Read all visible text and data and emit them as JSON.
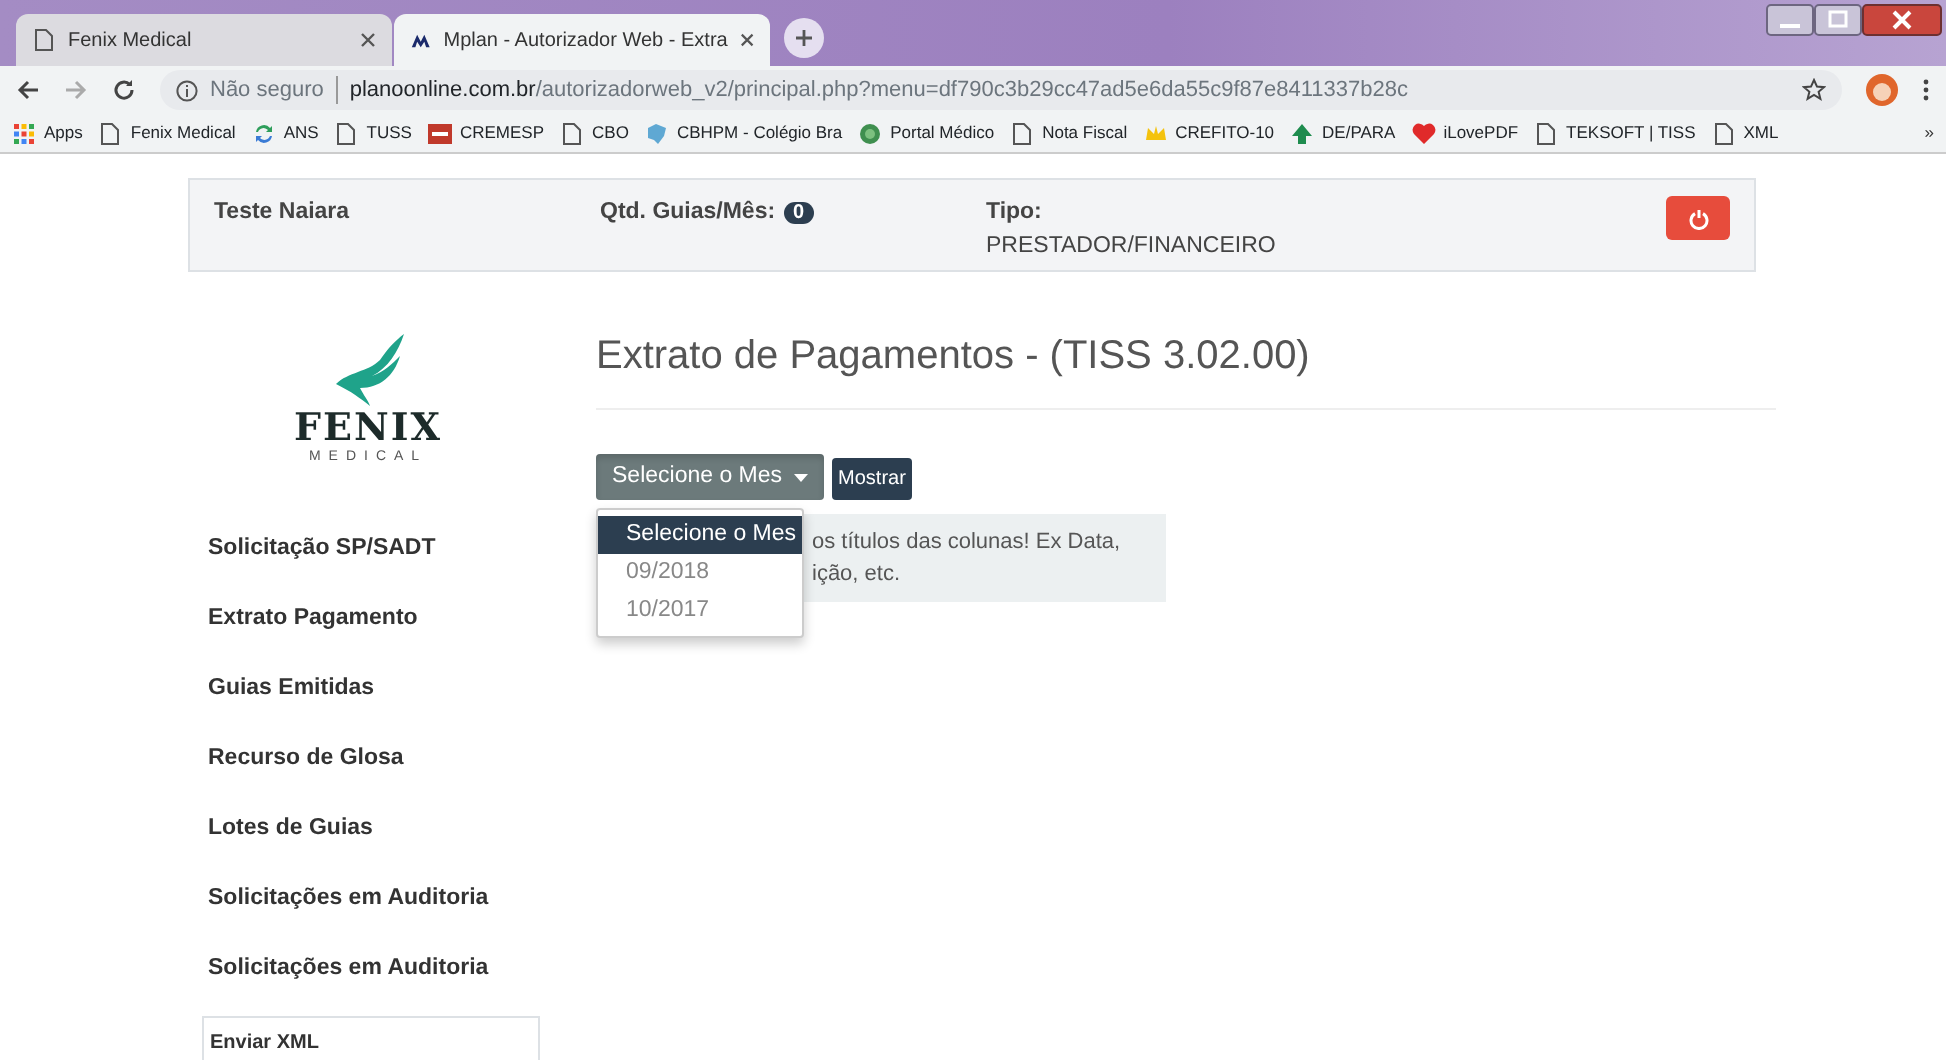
{
  "browser": {
    "tabs": [
      {
        "title": "Fenix Medical",
        "kind": "page",
        "selected": false
      },
      {
        "title": "Mplan - Autorizador Web - Extra",
        "kind": "mplan",
        "selected": true
      }
    ],
    "address": {
      "security": "Não seguro",
      "host": "planoonline.com.br",
      "path": "/autorizadorweb_v2/principal.php?menu=df790c3b29cc47ad5e6da55c9f87e8411337b28c"
    },
    "bookmarks": [
      {
        "label": "Apps",
        "kind": "apps"
      },
      {
        "label": "Fenix Medical",
        "kind": "page"
      },
      {
        "label": "ANS",
        "kind": "arrows"
      },
      {
        "label": "TUSS",
        "kind": "page"
      },
      {
        "label": "CREMESP",
        "kind": "badge"
      },
      {
        "label": "CBO",
        "kind": "page"
      },
      {
        "label": "CBHPM - Colégio Bra",
        "kind": "map"
      },
      {
        "label": "Portal Médico",
        "kind": "circle"
      },
      {
        "label": "Nota Fiscal",
        "kind": "page"
      },
      {
        "label": "CREFITO-10",
        "kind": "crown"
      },
      {
        "label": "DE/PARA",
        "kind": "tree"
      },
      {
        "label": "iLovePDF",
        "kind": "heart"
      },
      {
        "label": "TEKSOFT | TISS",
        "kind": "page"
      },
      {
        "label": "XML",
        "kind": "page"
      }
    ],
    "bookmarks_more": "»"
  },
  "header": {
    "user": "Teste Naiara",
    "qty_label": "Qtd. Guias/Mês:",
    "qty_count": "0",
    "tipo_label": "Tipo:",
    "tipo_value": "PRESTADOR/FINANCEIRO"
  },
  "sidebar": {
    "logo": {
      "name": "FENIX",
      "sub": "MEDICAL"
    },
    "items": [
      {
        "label": "Solicitação SP/SADT",
        "selected": false
      },
      {
        "label": "Extrato Pagamento",
        "selected": false
      },
      {
        "label": "Guias Emitidas",
        "selected": false
      },
      {
        "label": "Recurso de Glosa",
        "selected": false
      },
      {
        "label": "Lotes de Guias",
        "selected": false
      },
      {
        "label": "Solicitações em Auditoria",
        "selected": false
      },
      {
        "label": "Solicitações em Auditoria",
        "selected": false
      },
      {
        "label": "Enviar XML",
        "selected": true
      }
    ]
  },
  "main": {
    "title": "Extrato de Pagamentos - (TISS 3.02.00)",
    "month_select": {
      "label": "Selecione o Mes",
      "expanded": true
    },
    "show_button": "Mostrar",
    "month_options": [
      {
        "label": "Selecione o Mes",
        "selected": true
      },
      {
        "label": "09/2018",
        "selected": false
      },
      {
        "label": "10/2017",
        "selected": false
      }
    ],
    "hint": {
      "line_1": "os títulos das colunas! Ex Data,",
      "line_2": "ição, etc."
    }
  }
}
